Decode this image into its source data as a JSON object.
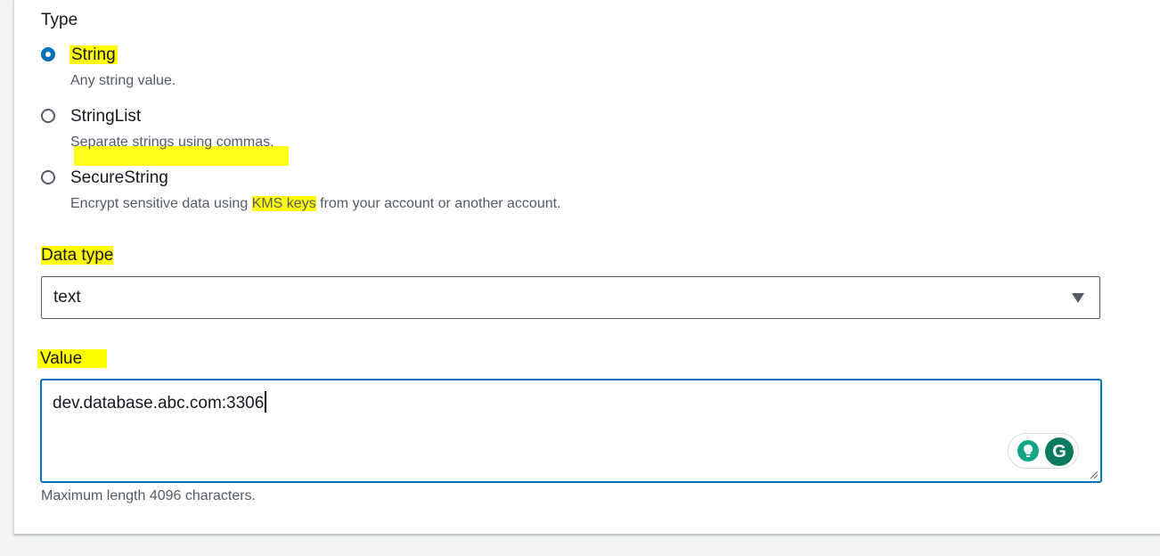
{
  "type_section": {
    "label": "Type",
    "options": [
      {
        "label": "String",
        "description": "Any string value.",
        "selected": true
      },
      {
        "label": "StringList",
        "description": "Separate strings using commas.",
        "selected": false
      },
      {
        "label": "SecureString",
        "description_before": "Encrypt sensitive data using ",
        "description_link": "KMS keys",
        "description_after": " from your account or another account.",
        "selected": false
      }
    ]
  },
  "data_type": {
    "label": "Data type",
    "selected_value": "text"
  },
  "value_field": {
    "label": "Value",
    "value": "dev.database.abc.com:3306",
    "constraint": "Maximum length 4096 characters."
  },
  "grammarly": {
    "bulb_icon": "lightbulb-icon",
    "logo_letter": "G"
  },
  "colors": {
    "accent": "#0073bb",
    "highlight": "#ffff00",
    "grammarly_green": "#0b7a5e"
  }
}
